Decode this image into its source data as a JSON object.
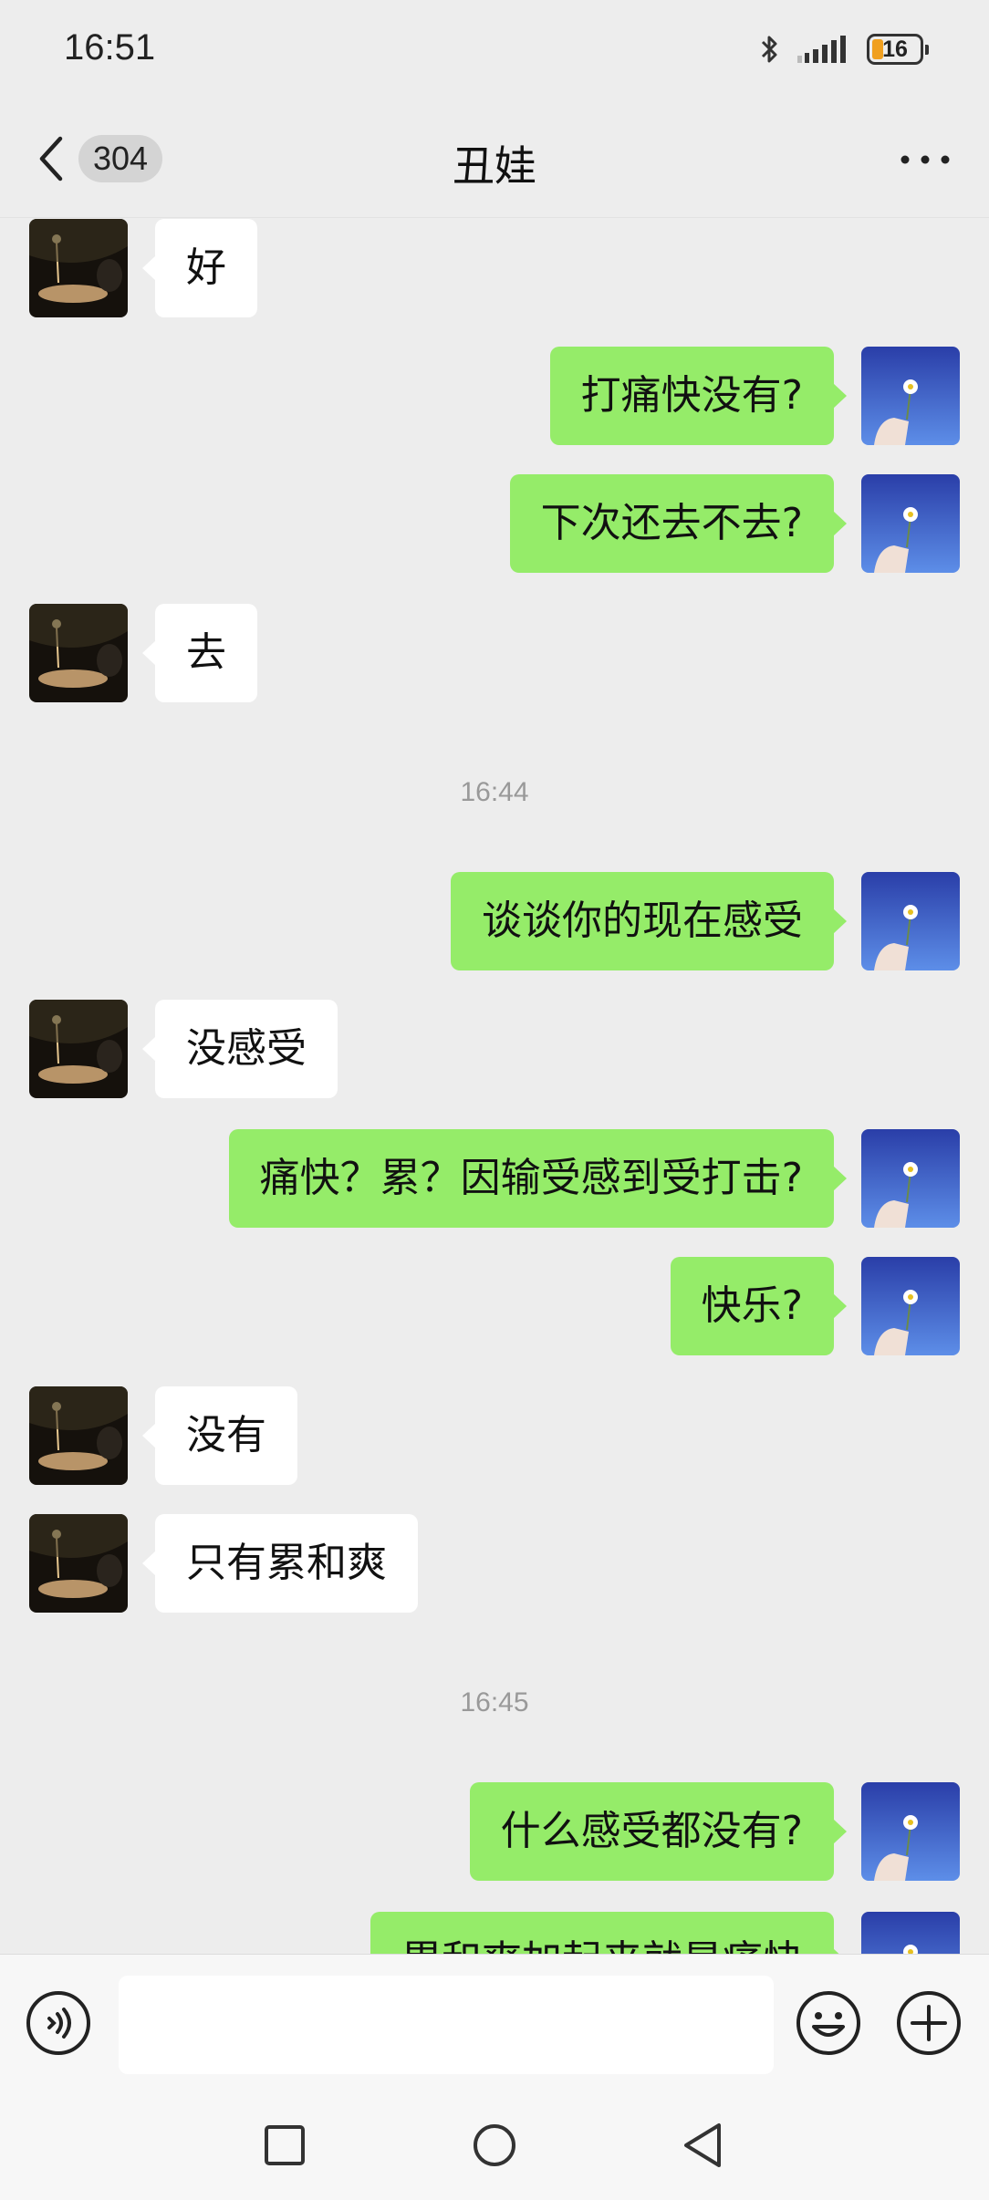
{
  "status_bar": {
    "time": "16:51",
    "battery_level": "16",
    "icons": [
      "bluetooth-icon",
      "cellular-signal-icon",
      "battery-icon"
    ]
  },
  "header": {
    "unread_count": "304",
    "title": "丑娃",
    "back_icon": "chevron-left-icon",
    "more_icon": "more-dots-icon"
  },
  "messages": [
    {
      "type": "in",
      "text": "好"
    },
    {
      "type": "out",
      "text": "打痛快没有?"
    },
    {
      "type": "out",
      "text": "下次还去不去?"
    },
    {
      "type": "in",
      "text": "去"
    },
    {
      "type": "time",
      "text": "16:44"
    },
    {
      "type": "out",
      "text": "谈谈你的现在感受"
    },
    {
      "type": "in",
      "text": "没感受"
    },
    {
      "type": "out",
      "text": "痛快？累？因输受感到受打击?"
    },
    {
      "type": "out",
      "text": "快乐?"
    },
    {
      "type": "in",
      "text": "没有"
    },
    {
      "type": "in",
      "text": "只有累和爽"
    },
    {
      "type": "time",
      "text": "16:45"
    },
    {
      "type": "out",
      "text": "什么感受都没有?"
    },
    {
      "type": "out",
      "text": "累和爽加起来就是痛快"
    }
  ],
  "input_bar": {
    "voice_icon": "voice-icon",
    "emoji_icon": "emoji-icon",
    "plus_icon": "plus-icon",
    "input_value": ""
  },
  "nav_bar": {
    "icons": [
      "recent-apps-icon",
      "home-icon",
      "back-triangle-icon"
    ]
  },
  "colors": {
    "background": "#ededed",
    "outgoing_bubble": "#95ec69",
    "incoming_bubble": "#ffffff",
    "battery_accent": "#f0a020"
  }
}
